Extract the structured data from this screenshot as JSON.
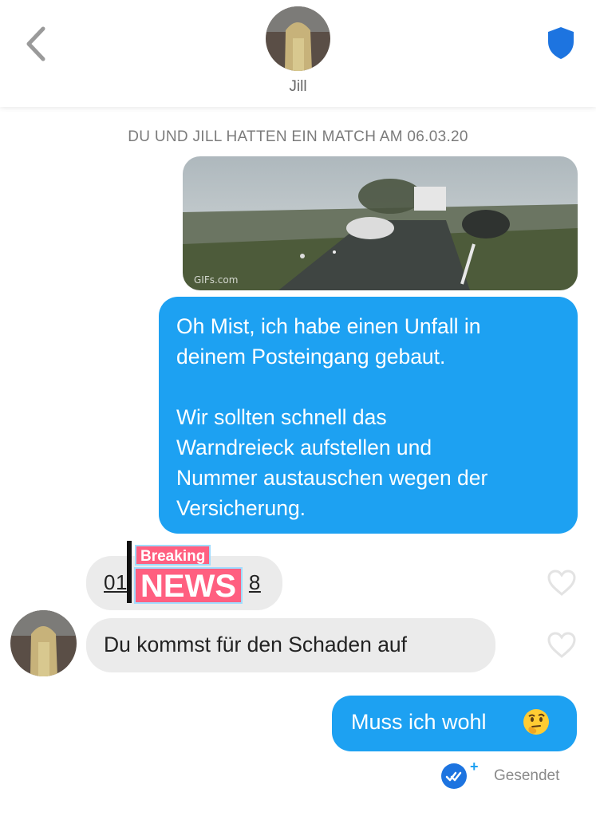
{
  "header": {
    "contact_name": "Jill",
    "back_icon": "chevron-left-icon",
    "safety_icon": "shield-icon",
    "accent_color": "#1d74e0"
  },
  "match_notice": "DU UND JILL HATTEN EIN MATCH AM 06.03.20",
  "messages": [
    {
      "type": "gif",
      "direction": "outgoing",
      "watermark": "GIFs.com"
    },
    {
      "type": "text",
      "direction": "outgoing",
      "lines": [
        "Oh Mist, ich habe einen Unfall in",
        "deinem Posteingang gebaut.",
        "",
        "Wir sollten schnell das",
        "Warndreieck aufstellen und",
        "Nummer austauschen wegen der",
        "Versicherung."
      ]
    },
    {
      "type": "text",
      "direction": "incoming",
      "text": "01",
      "text_suffix": "8",
      "overlay_top": "Breaking",
      "overlay_main": "NEWS"
    },
    {
      "type": "text",
      "direction": "incoming",
      "text": "Du kommst für den Schaden auf"
    },
    {
      "type": "text",
      "direction": "outgoing",
      "text": "Muss ich wohl",
      "emoji": "thinking-face-emoji"
    }
  ],
  "status": {
    "label": "Gesendet",
    "icon": "double-check-icon"
  },
  "colors": {
    "outgoing_bubble": "#1da1f2",
    "incoming_bubble": "#ebebeb",
    "breaking_news": "#ff5f80"
  }
}
